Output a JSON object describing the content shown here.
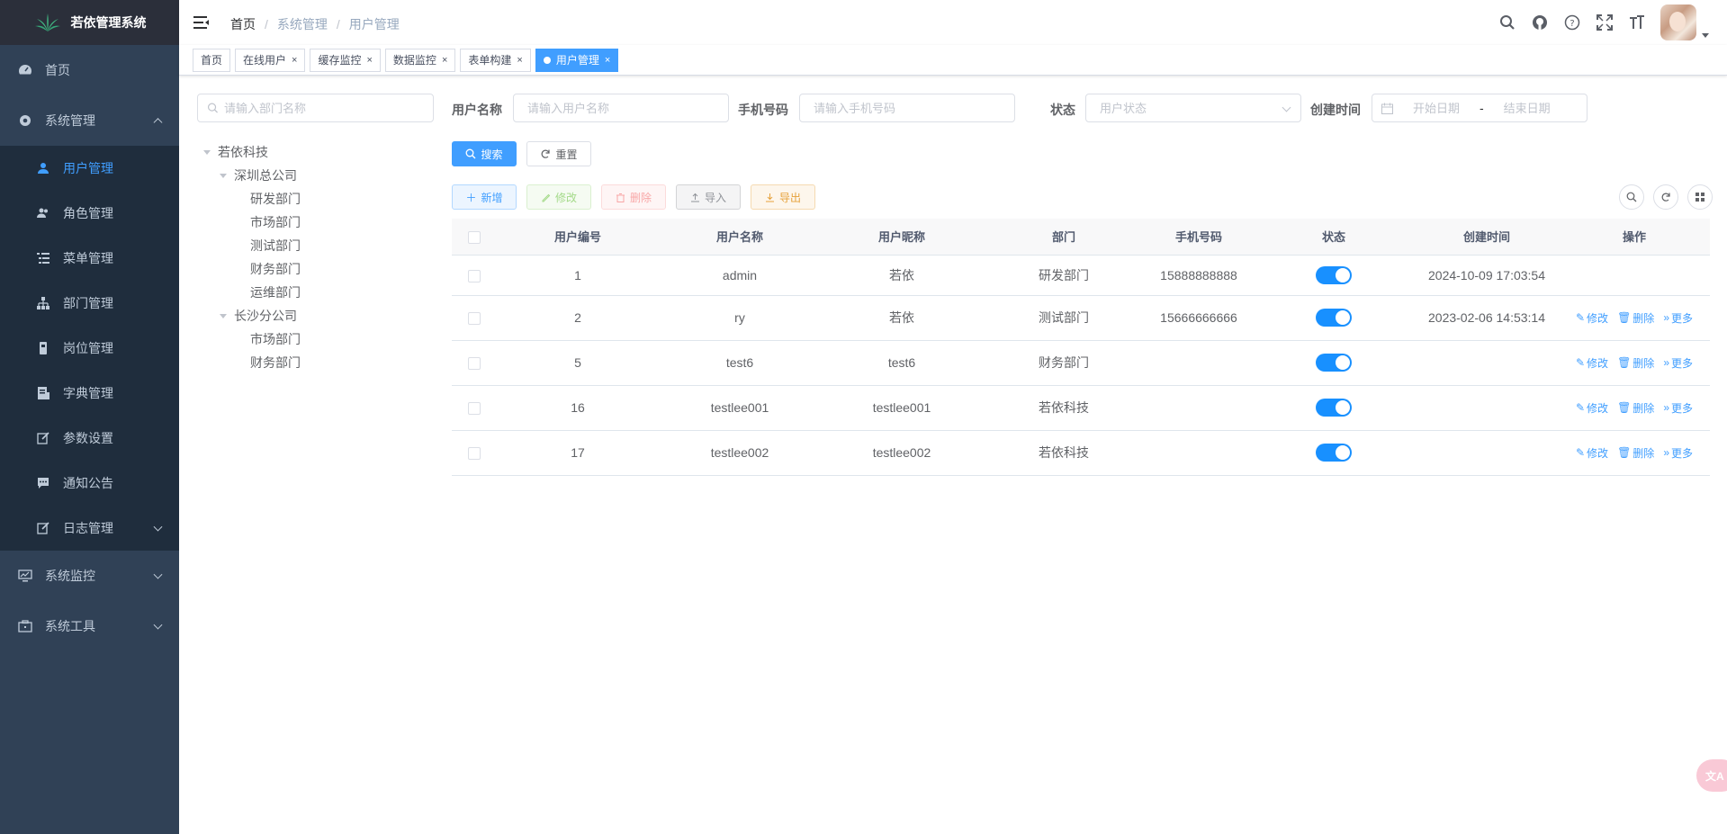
{
  "app": {
    "title": "若依管理系统"
  },
  "sidebar": {
    "home": "首页",
    "system": "系统管理",
    "items": [
      {
        "label": "用户管理",
        "icon": "user-icon",
        "active": true
      },
      {
        "label": "角色管理",
        "icon": "peoples-icon"
      },
      {
        "label": "菜单管理",
        "icon": "tree-table-icon"
      },
      {
        "label": "部门管理",
        "icon": "tree-icon"
      },
      {
        "label": "岗位管理",
        "icon": "post-icon"
      },
      {
        "label": "字典管理",
        "icon": "dict-icon"
      },
      {
        "label": "参数设置",
        "icon": "edit-icon"
      },
      {
        "label": "通知公告",
        "icon": "message-icon"
      },
      {
        "label": "日志管理",
        "icon": "log-icon"
      }
    ],
    "monitor": "系统监控",
    "tool": "系统工具"
  },
  "navbar": {
    "breadcrumb": [
      "首页",
      "系统管理",
      "用户管理"
    ]
  },
  "tags": [
    {
      "label": "首页",
      "closable": false
    },
    {
      "label": "在线用户",
      "closable": true
    },
    {
      "label": "缓存监控",
      "closable": true
    },
    {
      "label": "数据监控",
      "closable": true
    },
    {
      "label": "表单构建",
      "closable": true
    },
    {
      "label": "用户管理",
      "closable": true,
      "active": true
    }
  ],
  "tag_close": "×",
  "dept": {
    "placeholder": "请输入部门名称",
    "tree": {
      "root": "若依科技",
      "branch1": "深圳总公司",
      "branch1_children": [
        "研发部门",
        "市场部门",
        "测试部门",
        "财务部门",
        "运维部门"
      ],
      "branch2": "长沙分公司",
      "branch2_children": [
        "市场部门",
        "财务部门"
      ]
    }
  },
  "search": {
    "username_label": "用户名称",
    "username_placeholder": "请输入用户名称",
    "phone_label": "手机号码",
    "phone_placeholder": "请输入手机号码",
    "status_label": "状态",
    "status_placeholder": "用户状态",
    "created_label": "创建时间",
    "start_placeholder": "开始日期",
    "range_sep": "-",
    "end_placeholder": "结束日期",
    "search_btn": "搜索",
    "reset_btn": "重置"
  },
  "toolbar": {
    "add": "新增",
    "edit": "修改",
    "delete": "删除",
    "import": "导入",
    "export": "导出"
  },
  "table": {
    "headers": [
      "用户编号",
      "用户名称",
      "用户昵称",
      "部门",
      "手机号码",
      "状态",
      "创建时间",
      "操作"
    ],
    "rows": [
      {
        "id": "1",
        "username": "admin",
        "nickname": "若依",
        "dept": "研发部门",
        "phone": "15888888888",
        "status": true,
        "created": "2024-10-09 17:03:54",
        "ops": false
      },
      {
        "id": "2",
        "username": "ry",
        "nickname": "若依",
        "dept": "测试部门",
        "phone": "15666666666",
        "status": true,
        "created": "2023-02-06 14:53:14",
        "ops": true
      },
      {
        "id": "5",
        "username": "test6",
        "nickname": "test6",
        "dept": "财务部门",
        "phone": "",
        "status": true,
        "created": "",
        "ops": true
      },
      {
        "id": "16",
        "username": "testlee001",
        "nickname": "testlee001",
        "dept": "若依科技",
        "phone": "",
        "status": true,
        "created": "",
        "ops": true
      },
      {
        "id": "17",
        "username": "testlee002",
        "nickname": "testlee002",
        "dept": "若依科技",
        "phone": "",
        "status": true,
        "created": "",
        "ops": true
      }
    ],
    "op_edit": "修改",
    "op_delete": "删除",
    "op_more": "更多"
  },
  "colors": {
    "primary": "#409eff",
    "sidebar": "#304156",
    "sidebar_sub": "#1f2d3d",
    "switch_on": "#1890ff"
  }
}
